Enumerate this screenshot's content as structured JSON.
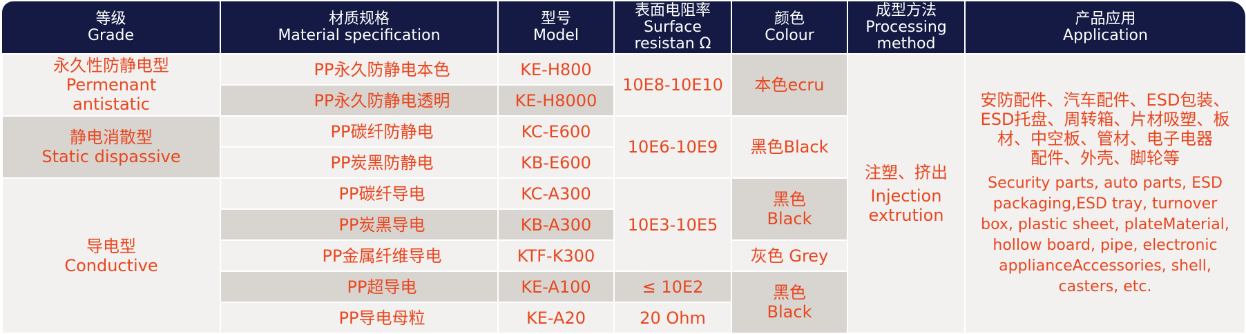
{
  "header": {
    "grade": {
      "zh": "等级",
      "en": "Grade"
    },
    "material": {
      "zh": "材质规格",
      "en": "Material specification"
    },
    "model": {
      "zh": "型号",
      "en": "Model"
    },
    "resistance": {
      "zh": "表面电阻率",
      "en1": "Surface",
      "en2": "resistan Ω"
    },
    "colour": {
      "zh": "颜色",
      "en": "Colour"
    },
    "processing": {
      "zh": "成型方法",
      "en1": "Processing",
      "en2": "method"
    },
    "application": {
      "zh": "产品应用",
      "en": "Application"
    }
  },
  "grades": [
    {
      "zh": "永久性防静电型",
      "en1": "Permenant",
      "en2": "antistatic"
    },
    {
      "zh": "静电消散型",
      "en1": "Static dispassive"
    },
    {
      "zh": "导电型",
      "en1": "Conductive"
    }
  ],
  "rows": [
    {
      "material": "PP永久防静电本色",
      "model": "KE-H800"
    },
    {
      "material": "PP永久防静电透明",
      "model": "KE-H8000"
    },
    {
      "material": "PP碳纤防静电",
      "model": "KC-E600"
    },
    {
      "material": "PP炭黑防静电",
      "model": "KB-E600"
    },
    {
      "material": "PP碳纤导电",
      "model": "KC-A300"
    },
    {
      "material": "PP炭黑导电",
      "model": "KB-A300"
    },
    {
      "material": "PP金属纤维导电",
      "model": "KTF-K300"
    },
    {
      "material": "PP超导电",
      "model": "KE-A100"
    },
    {
      "material": "PP导电母粒",
      "model": "KE-A20"
    }
  ],
  "resistance": [
    "10E8-10E10",
    "10E6-10E9",
    "10E3-10E5",
    "≤ 10E2",
    "20 Ohm"
  ],
  "colours": [
    {
      "line1": "本色ecru"
    },
    {
      "line1": "黑色Black"
    },
    {
      "line1": "黑色",
      "line2": "Black"
    },
    {
      "line1": "灰色 Grey"
    },
    {
      "line1": "黑色",
      "line2": "Black"
    }
  ],
  "processing": {
    "zh": "注塑、挤出",
    "en1": "Injection",
    "en2": "extrution"
  },
  "application": {
    "zh": [
      "安防配件、汽车配件、ESD包装、",
      "ESD托盘、周转箱、片材吸塑、板",
      "材、中空板、管材、电子电器",
      "配件、外壳、脚轮等"
    ],
    "en": [
      "Security parts, auto parts, ESD",
      "packaging,ESD tray, turnover",
      "box, plastic sheet, plateMaterial,",
      "hollow board, pipe, electronic",
      "applianceAccessories, shell,",
      "casters, etc."
    ]
  }
}
